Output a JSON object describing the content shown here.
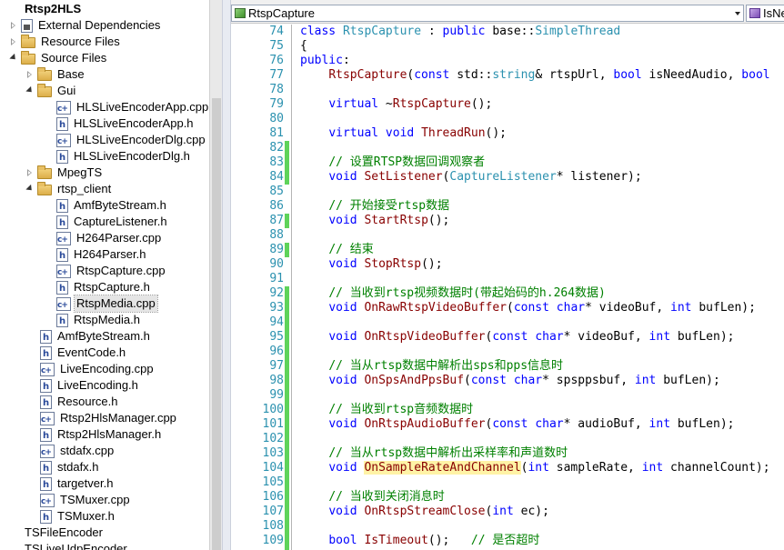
{
  "solution_explorer": {
    "items": [
      {
        "label": "Rtsp2HLS",
        "icon": "project-icon",
        "kind": "project",
        "depth": 0,
        "arrow": "none"
      },
      {
        "label": "External Dependencies",
        "icon": "dependencies-icon",
        "kind": "deps",
        "depth": 1,
        "arrow": "closed"
      },
      {
        "label": "Resource Files",
        "icon": "folder-icon",
        "kind": "folder",
        "depth": 1,
        "arrow": "closed"
      },
      {
        "label": "Source Files",
        "icon": "folder-icon",
        "kind": "folder",
        "depth": 1,
        "arrow": "open"
      },
      {
        "label": "Base",
        "icon": "folder-icon",
        "kind": "folder",
        "depth": 2,
        "arrow": "closed"
      },
      {
        "label": "Gui",
        "icon": "folder-icon",
        "kind": "folder",
        "depth": 2,
        "arrow": "open"
      },
      {
        "label": "HLSLiveEncoderApp.cpp",
        "icon": "cpp-file-icon",
        "kind": "cpp",
        "depth": 3,
        "arrow": "none"
      },
      {
        "label": "HLSLiveEncoderApp.h",
        "icon": "header-file-icon",
        "kind": "file",
        "depth": 3,
        "arrow": "none"
      },
      {
        "label": "HLSLiveEncoderDlg.cpp",
        "icon": "cpp-file-icon",
        "kind": "cpp",
        "depth": 3,
        "arrow": "none"
      },
      {
        "label": "HLSLiveEncoderDlg.h",
        "icon": "header-file-icon",
        "kind": "file",
        "depth": 3,
        "arrow": "none"
      },
      {
        "label": "MpegTS",
        "icon": "folder-icon",
        "kind": "folder",
        "depth": 2,
        "arrow": "closed"
      },
      {
        "label": "rtsp_client",
        "icon": "folder-icon",
        "kind": "folder",
        "depth": 2,
        "arrow": "open"
      },
      {
        "label": "AmfByteStream.h",
        "icon": "header-file-icon",
        "kind": "file",
        "depth": 3,
        "arrow": "none"
      },
      {
        "label": "CaptureListener.h",
        "icon": "header-file-icon",
        "kind": "file",
        "depth": 3,
        "arrow": "none"
      },
      {
        "label": "H264Parser.cpp",
        "icon": "cpp-file-icon",
        "kind": "cpp",
        "depth": 3,
        "arrow": "none"
      },
      {
        "label": "H264Parser.h",
        "icon": "header-file-icon",
        "kind": "file",
        "depth": 3,
        "arrow": "none"
      },
      {
        "label": "RtspCapture.cpp",
        "icon": "cpp-file-icon",
        "kind": "cpp",
        "depth": 3,
        "arrow": "none"
      },
      {
        "label": "RtspCapture.h",
        "icon": "header-file-icon",
        "kind": "file",
        "depth": 3,
        "arrow": "none"
      },
      {
        "label": "RtspMedia.cpp",
        "icon": "cpp-file-icon",
        "kind": "cpp",
        "depth": 3,
        "arrow": "none",
        "selected": true
      },
      {
        "label": "RtspMedia.h",
        "icon": "header-file-icon",
        "kind": "file",
        "depth": 3,
        "arrow": "none"
      },
      {
        "label": "AmfByteStream.h",
        "icon": "header-file-icon",
        "kind": "file",
        "depth": 2,
        "arrow": "none"
      },
      {
        "label": "EventCode.h",
        "icon": "header-file-icon",
        "kind": "file",
        "depth": 2,
        "arrow": "none"
      },
      {
        "label": "LiveEncoding.cpp",
        "icon": "cpp-file-icon",
        "kind": "cpp",
        "depth": 2,
        "arrow": "none"
      },
      {
        "label": "LiveEncoding.h",
        "icon": "header-file-icon",
        "kind": "file",
        "depth": 2,
        "arrow": "none"
      },
      {
        "label": "Resource.h",
        "icon": "header-file-icon",
        "kind": "file",
        "depth": 2,
        "arrow": "none"
      },
      {
        "label": "Rtsp2HlsManager.cpp",
        "icon": "cpp-file-icon",
        "kind": "cpp",
        "depth": 2,
        "arrow": "none"
      },
      {
        "label": "Rtsp2HlsManager.h",
        "icon": "header-file-icon",
        "kind": "file",
        "depth": 2,
        "arrow": "none"
      },
      {
        "label": "stdafx.cpp",
        "icon": "cpp-file-icon",
        "kind": "cpp",
        "depth": 2,
        "arrow": "none"
      },
      {
        "label": "stdafx.h",
        "icon": "header-file-icon",
        "kind": "file",
        "depth": 2,
        "arrow": "none"
      },
      {
        "label": "targetver.h",
        "icon": "header-file-icon",
        "kind": "file",
        "depth": 2,
        "arrow": "none"
      },
      {
        "label": "TSMuxer.cpp",
        "icon": "cpp-file-icon",
        "kind": "cpp",
        "depth": 2,
        "arrow": "none"
      },
      {
        "label": "TSMuxer.h",
        "icon": "header-file-icon",
        "kind": "file",
        "depth": 2,
        "arrow": "none"
      },
      {
        "label": "TSFileEncoder",
        "icon": "project-icon",
        "kind": "project",
        "depth": 0,
        "arrow": "none"
      },
      {
        "label": "TSLiveUdpEncoder",
        "icon": "project-icon",
        "kind": "project",
        "depth": 0,
        "arrow": "none"
      }
    ]
  },
  "editor": {
    "class_combo": "RtspCapture",
    "member_combo": "IsNe",
    "changed_line_groups": [
      [
        82,
        84
      ],
      [
        87,
        87
      ],
      [
        89,
        89
      ],
      [
        92,
        110
      ]
    ],
    "fold_lines": [],
    "lines": [
      {
        "n": "74",
        "tokens": [
          [
            "kw",
            "class"
          ],
          [
            "",
            " "
          ],
          [
            "ty",
            "RtspCapture"
          ],
          [
            "",
            " : "
          ],
          [
            "kw",
            "public"
          ],
          [
            "",
            " base::"
          ],
          [
            "ty",
            "SimpleThread"
          ]
        ]
      },
      {
        "n": "75",
        "tokens": [
          [
            "",
            "{"
          ]
        ]
      },
      {
        "n": "76",
        "tokens": [
          [
            "kw",
            "public"
          ],
          [
            "",
            ":"
          ]
        ]
      },
      {
        "n": "77",
        "tokens": [
          [
            "",
            "    "
          ],
          [
            "fn",
            "RtspCapture"
          ],
          [
            "",
            "("
          ],
          [
            "kw",
            "const"
          ],
          [
            "",
            " std::"
          ],
          [
            "ty",
            "string"
          ],
          [
            "",
            "& rtspUrl, "
          ],
          [
            "kw",
            "bool"
          ],
          [
            "",
            " isNeedAudio, "
          ],
          [
            "kw",
            "bool"
          ]
        ]
      },
      {
        "n": "78",
        "tokens": [
          [
            "",
            ""
          ]
        ]
      },
      {
        "n": "79",
        "tokens": [
          [
            "",
            "    "
          ],
          [
            "kw",
            "virtual"
          ],
          [
            "",
            " ~"
          ],
          [
            "fn",
            "RtspCapture"
          ],
          [
            "",
            "();"
          ]
        ]
      },
      {
        "n": "80",
        "tokens": [
          [
            "",
            ""
          ]
        ]
      },
      {
        "n": "81",
        "tokens": [
          [
            "",
            "    "
          ],
          [
            "kw",
            "virtual"
          ],
          [
            "",
            ""
          ],
          [
            "kw",
            " void"
          ],
          [
            "",
            " "
          ],
          [
            "fn",
            "ThreadRun"
          ],
          [
            "",
            "();"
          ]
        ]
      },
      {
        "n": "82",
        "tokens": [
          [
            "",
            ""
          ]
        ]
      },
      {
        "n": "83",
        "tokens": [
          [
            "",
            "    "
          ],
          [
            "cm",
            "// 设置RTSP数据回调观察者"
          ]
        ]
      },
      {
        "n": "84",
        "tokens": [
          [
            "",
            "    "
          ],
          [
            "kw",
            "void"
          ],
          [
            "",
            " "
          ],
          [
            "fn",
            "SetListener"
          ],
          [
            "",
            "("
          ],
          [
            "ty",
            "CaptureListener"
          ],
          [
            "",
            "* listener);"
          ]
        ]
      },
      {
        "n": "85",
        "tokens": [
          [
            "",
            ""
          ]
        ]
      },
      {
        "n": "86",
        "tokens": [
          [
            "",
            "    "
          ],
          [
            "cm",
            "// 开始接受rtsp数据"
          ]
        ]
      },
      {
        "n": "87",
        "tokens": [
          [
            "",
            "    "
          ],
          [
            "kw",
            "void"
          ],
          [
            "",
            " "
          ],
          [
            "fn",
            "StartRtsp"
          ],
          [
            "",
            "();"
          ]
        ]
      },
      {
        "n": "88",
        "tokens": [
          [
            "",
            ""
          ]
        ]
      },
      {
        "n": "89",
        "tokens": [
          [
            "",
            "    "
          ],
          [
            "cm",
            "// 结束"
          ]
        ]
      },
      {
        "n": "90",
        "tokens": [
          [
            "",
            "    "
          ],
          [
            "kw",
            "void"
          ],
          [
            "",
            " "
          ],
          [
            "fn",
            "StopRtsp"
          ],
          [
            "",
            "();"
          ]
        ]
      },
      {
        "n": "91",
        "tokens": [
          [
            "",
            ""
          ]
        ]
      },
      {
        "n": "92",
        "tokens": [
          [
            "",
            "    "
          ],
          [
            "cm",
            "// 当收到rtsp视频数据时(带起始码的h.264数据)"
          ]
        ]
      },
      {
        "n": "93",
        "tokens": [
          [
            "",
            "    "
          ],
          [
            "kw",
            "void"
          ],
          [
            "",
            " "
          ],
          [
            "fn",
            "OnRawRtspVideoBuffer"
          ],
          [
            "",
            "("
          ],
          [
            "kw",
            "const"
          ],
          [
            "",
            " "
          ],
          [
            "kw",
            "char"
          ],
          [
            "",
            "* videoBuf, "
          ],
          [
            "kw",
            "int"
          ],
          [
            "",
            " bufLen);"
          ]
        ]
      },
      {
        "n": "94",
        "tokens": [
          [
            "",
            ""
          ]
        ]
      },
      {
        "n": "95",
        "tokens": [
          [
            "",
            "    "
          ],
          [
            "kw",
            "void"
          ],
          [
            "",
            " "
          ],
          [
            "fn",
            "OnRtspVideoBuffer"
          ],
          [
            "",
            "("
          ],
          [
            "kw",
            "const"
          ],
          [
            "",
            " "
          ],
          [
            "kw",
            "char"
          ],
          [
            "",
            "* videoBuf, "
          ],
          [
            "kw",
            "int"
          ],
          [
            "",
            " bufLen);"
          ]
        ]
      },
      {
        "n": "96",
        "tokens": [
          [
            "",
            ""
          ]
        ]
      },
      {
        "n": "97",
        "tokens": [
          [
            "",
            "    "
          ],
          [
            "cm",
            "// 当从rtsp数据中解析出sps和pps信息时"
          ]
        ]
      },
      {
        "n": "98",
        "tokens": [
          [
            "",
            "    "
          ],
          [
            "kw",
            "void"
          ],
          [
            "",
            " "
          ],
          [
            "fn",
            "OnSpsAndPpsBuf"
          ],
          [
            "",
            "("
          ],
          [
            "kw",
            "const"
          ],
          [
            "",
            " "
          ],
          [
            "kw",
            "char"
          ],
          [
            "",
            "* spsppsbuf, "
          ],
          [
            "kw",
            "int"
          ],
          [
            "",
            " bufLen);"
          ]
        ]
      },
      {
        "n": "99",
        "tokens": [
          [
            "",
            ""
          ]
        ]
      },
      {
        "n": "100",
        "tokens": [
          [
            "",
            "    "
          ],
          [
            "cm",
            "// 当收到rtsp音频数据时"
          ]
        ]
      },
      {
        "n": "101",
        "tokens": [
          [
            "",
            "    "
          ],
          [
            "kw",
            "void"
          ],
          [
            "",
            " "
          ],
          [
            "fn",
            "OnRtspAudioBuffer"
          ],
          [
            "",
            "("
          ],
          [
            "kw",
            "const"
          ],
          [
            "",
            " "
          ],
          [
            "kw",
            "char"
          ],
          [
            "",
            "* audioBuf, "
          ],
          [
            "kw",
            "int"
          ],
          [
            "",
            " bufLen);"
          ]
        ]
      },
      {
        "n": "102",
        "tokens": [
          [
            "",
            ""
          ]
        ]
      },
      {
        "n": "103",
        "tokens": [
          [
            "",
            "    "
          ],
          [
            "cm",
            "// 当从rtsp数据中解析出采样率和声道数时"
          ]
        ]
      },
      {
        "n": "104",
        "tokens": [
          [
            "",
            "    "
          ],
          [
            "kw",
            "void"
          ],
          [
            "",
            " "
          ],
          [
            "fn hl",
            "OnSampleRateAndChannel"
          ],
          [
            "",
            "("
          ],
          [
            "kw",
            "int"
          ],
          [
            "",
            " sampleRate, "
          ],
          [
            "kw",
            "int"
          ],
          [
            "",
            " channelCount);"
          ]
        ]
      },
      {
        "n": "105",
        "tokens": [
          [
            "",
            ""
          ]
        ]
      },
      {
        "n": "106",
        "tokens": [
          [
            "",
            "    "
          ],
          [
            "cm",
            "// 当收到关闭消息时"
          ]
        ]
      },
      {
        "n": "107",
        "tokens": [
          [
            "",
            "    "
          ],
          [
            "kw",
            "void"
          ],
          [
            "",
            " "
          ],
          [
            "fn",
            "OnRtspStreamClose"
          ],
          [
            "",
            "("
          ],
          [
            "kw",
            "int"
          ],
          [
            "",
            " ec);"
          ]
        ]
      },
      {
        "n": "108",
        "tokens": [
          [
            "",
            ""
          ]
        ]
      },
      {
        "n": "109",
        "tokens": [
          [
            "",
            "    "
          ],
          [
            "kw",
            "bool"
          ],
          [
            "",
            " "
          ],
          [
            "fn",
            "IsTimeout"
          ],
          [
            "",
            "();   "
          ],
          [
            "cm",
            "// 是否超时"
          ]
        ]
      }
    ]
  }
}
